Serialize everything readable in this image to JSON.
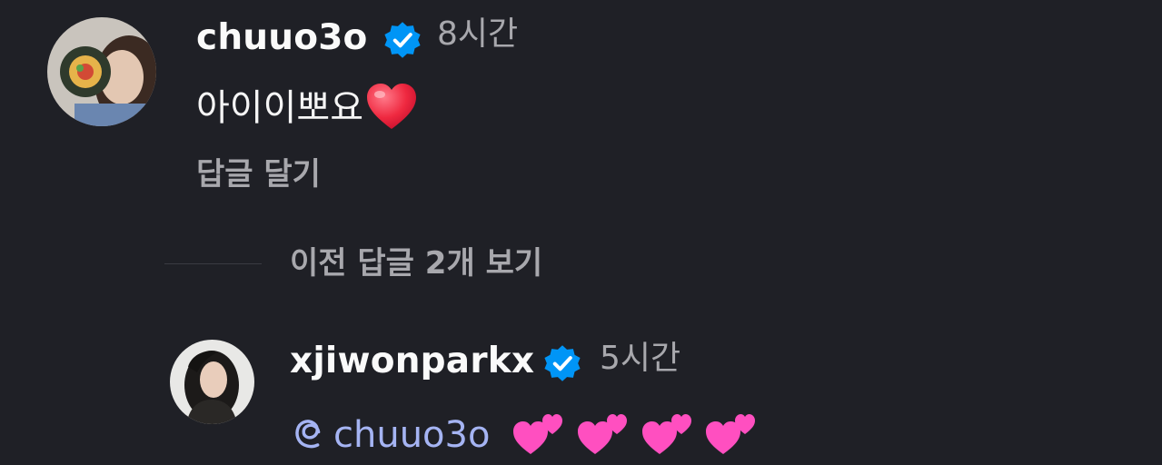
{
  "comment": {
    "username": "chuuo3o",
    "time": "8시간",
    "text": "아이이뽀요",
    "reply_label": "답글 달기"
  },
  "view_replies_label": "이전 답글 2개 보기",
  "reply": {
    "username": "xjiwonparkx",
    "time": "5시간",
    "mention": "chuuo3o"
  },
  "colors": {
    "background": "#1f2026",
    "verified": "#0095f6",
    "muted": "#a8a8ad",
    "mention": "#a5b4f3"
  }
}
